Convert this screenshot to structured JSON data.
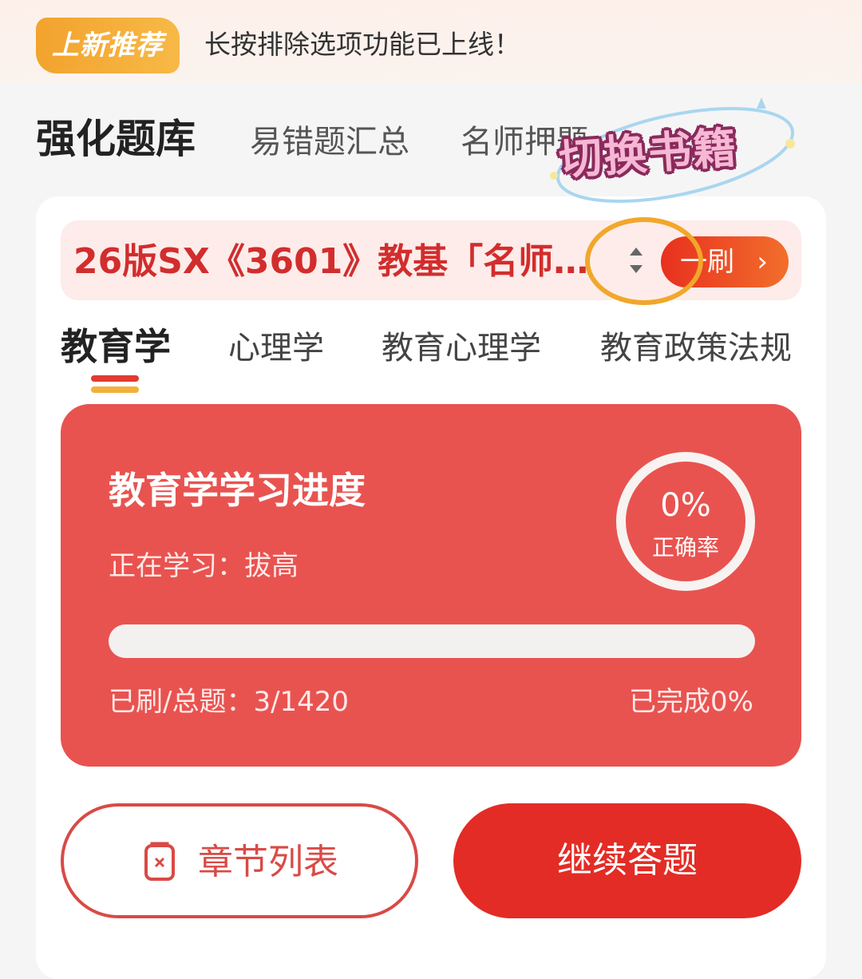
{
  "notice": {
    "badge": "上新推荐",
    "text": "长按排除选项功能已上线！"
  },
  "top_tabs": [
    "强化题库",
    "易错题汇总",
    "名师押题"
  ],
  "sticker": "切换书籍",
  "book": {
    "title": "26版SX《3601》教基「名师…",
    "round_button": "一刷",
    "chevron": "›"
  },
  "subjects": [
    "教育学",
    "心理学",
    "教育心理学",
    "教育政策法规"
  ],
  "progress": {
    "title": "教育学学习进度",
    "studying": "正在学习：拔高",
    "accuracy_value": "0%",
    "accuracy_label": "正确率",
    "count": "已刷/总题：3/1420",
    "done": "已完成0%",
    "completed_fraction": 0
  },
  "buttons": {
    "chapters": "章节列表",
    "continue": "继续答题"
  },
  "colors": {
    "accent_red": "#e32c26",
    "card_red": "#e85350",
    "badge_orange": "#f2a32e",
    "highlight_ring": "#f1a72a"
  },
  "icons": {
    "sort": "sort-updown-icon",
    "chapter": "document-x-icon"
  }
}
